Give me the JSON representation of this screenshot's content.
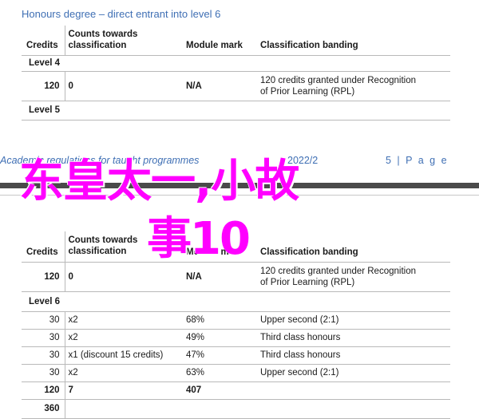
{
  "top_heading": "Honours degree – direct entrant into level 6",
  "columns": {
    "credits": "Credits",
    "counts_line1": "Counts towards",
    "counts_line2": "classification",
    "module_mark": "Module mark",
    "banding": "Classification banding"
  },
  "table1": {
    "level4": "Level 4",
    "row": {
      "credits": "120",
      "counts": "0",
      "mark": "N/A",
      "band_line1": "120 credits granted under Recognition",
      "band_line2": "of Prior Learning (RPL)"
    },
    "level5": "Level 5"
  },
  "footer": {
    "left": "Academic regulations for taught programmes",
    "date": "2022/2",
    "page": "5 | P a g e"
  },
  "overlay": {
    "line1": "东皇太一,小故",
    "line2": "事10"
  },
  "table2": {
    "row": {
      "credits": "120",
      "counts": "0",
      "mark": "N/A",
      "band_line1": "120 credits granted under Recognition",
      "band_line2": "of Prior Learning (RPL)"
    },
    "level6": "Level 6",
    "modules": [
      {
        "credits": "30",
        "counts": "x2",
        "mark": "68%",
        "band": "Upper second (2:1)"
      },
      {
        "credits": "30",
        "counts": "x2",
        "mark": "49%",
        "band": "Third class honours"
      },
      {
        "credits": "30",
        "counts": "x1 (discount 15 credits)",
        "mark": "47%",
        "band": "Third class honours"
      },
      {
        "credits": "30",
        "counts": "x2",
        "mark": "63%",
        "band": "Upper second (2:1)"
      }
    ],
    "total": {
      "credits": "120",
      "counts": "7",
      "mark": "407"
    },
    "grand_total": "360"
  }
}
